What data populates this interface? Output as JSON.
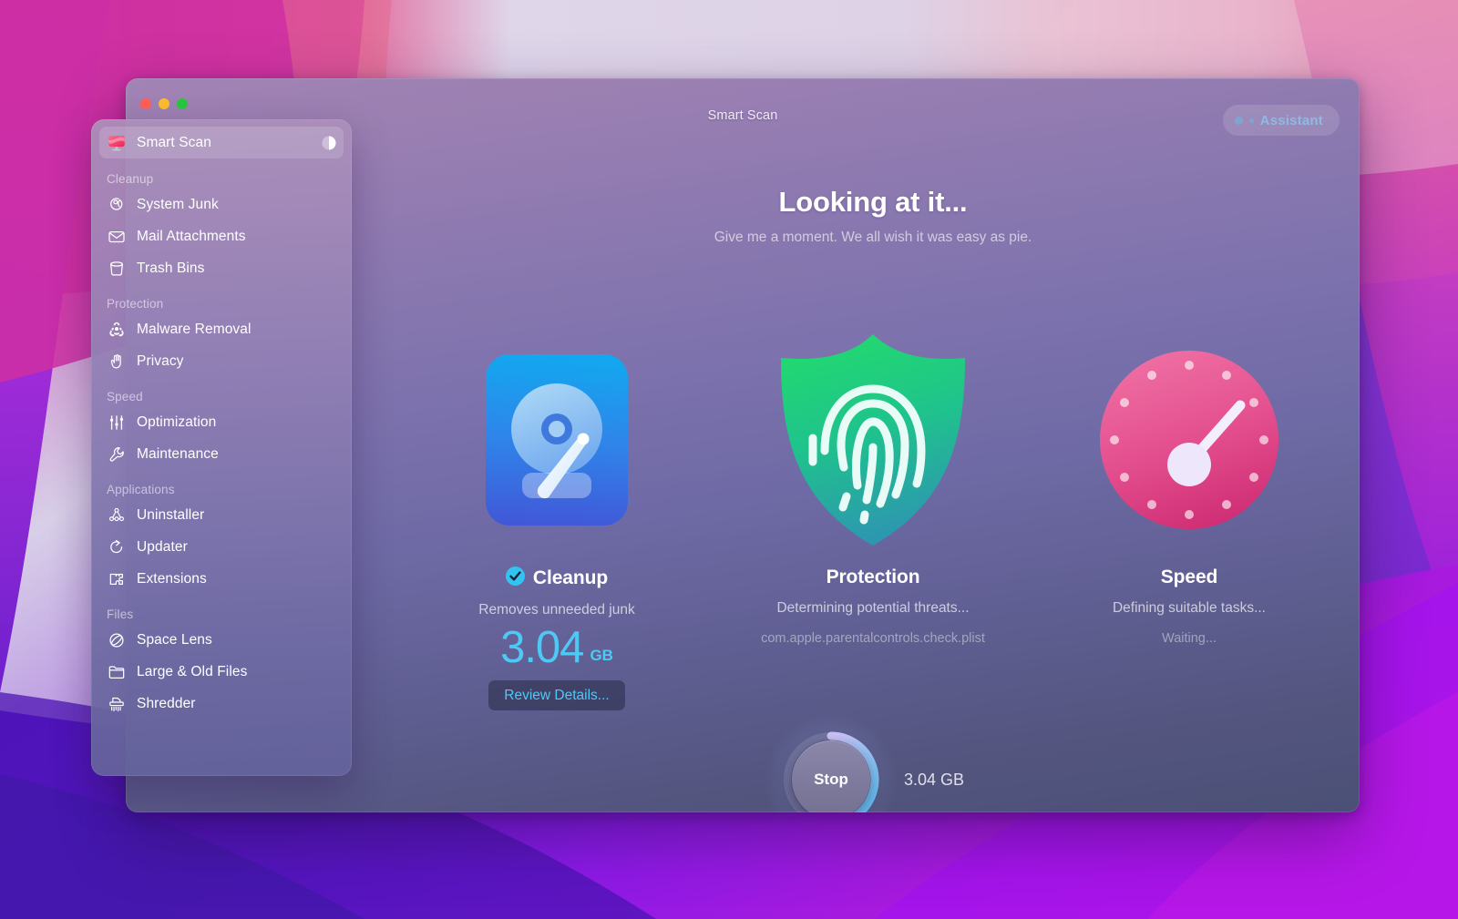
{
  "window": {
    "title": "Smart Scan",
    "traffic_lights": [
      "close",
      "minimize",
      "zoom"
    ],
    "assistant": {
      "label": "Assistant",
      "color": "#8fb9e0"
    }
  },
  "sidebar": {
    "active_item": "Smart Scan",
    "top_item": {
      "label": "Smart Scan",
      "icon": "monitor-icon",
      "progress_icon": "pie-progress-icon"
    },
    "groups": [
      {
        "title": "Cleanup",
        "items": [
          {
            "label": "System Junk",
            "icon": "broom-icon"
          },
          {
            "label": "Mail Attachments",
            "icon": "envelope-icon"
          },
          {
            "label": "Trash Bins",
            "icon": "trash-bin-icon"
          }
        ]
      },
      {
        "title": "Protection",
        "items": [
          {
            "label": "Malware Removal",
            "icon": "biohazard-icon"
          },
          {
            "label": "Privacy",
            "icon": "hand-icon"
          }
        ]
      },
      {
        "title": "Speed",
        "items": [
          {
            "label": "Optimization",
            "icon": "sliders-icon"
          },
          {
            "label": "Maintenance",
            "icon": "wrench-icon"
          }
        ]
      },
      {
        "title": "Applications",
        "items": [
          {
            "label": "Uninstaller",
            "icon": "app-grid-icon"
          },
          {
            "label": "Updater",
            "icon": "refresh-arrow-icon"
          },
          {
            "label": "Extensions",
            "icon": "puzzle-piece-icon"
          }
        ]
      },
      {
        "title": "Files",
        "items": [
          {
            "label": "Space Lens",
            "icon": "planet-icon"
          },
          {
            "label": "Large & Old Files",
            "icon": "folder-icon"
          },
          {
            "label": "Shredder",
            "icon": "shredder-icon"
          }
        ]
      }
    ]
  },
  "main": {
    "headline": "Looking at it...",
    "subhead": "Give me a moment. We all wish it was easy as pie.",
    "cards": [
      {
        "id": "cleanup",
        "title": "Cleanup",
        "icon": "hard-drive-icon",
        "status_icon": "check-circle-icon",
        "description": "Removes unneeded junk",
        "size_value": "3.04",
        "size_unit": "GB",
        "button_label": "Review Details...",
        "accent": "#4ec8f5"
      },
      {
        "id": "protection",
        "title": "Protection",
        "icon": "shield-fingerprint-icon",
        "description": "Determining potential threats...",
        "detail": "com.apple.parentalcontrols.check.plist",
        "accent": "#2fc07c"
      },
      {
        "id": "speed",
        "title": "Speed",
        "icon": "speed-gauge-icon",
        "description": "Defining suitable tasks...",
        "detail": "Waiting...",
        "accent": "#e0578f"
      }
    ]
  },
  "footer": {
    "stop_label": "Stop",
    "scan_size": "3.04 GB",
    "progress_percent": 42
  }
}
